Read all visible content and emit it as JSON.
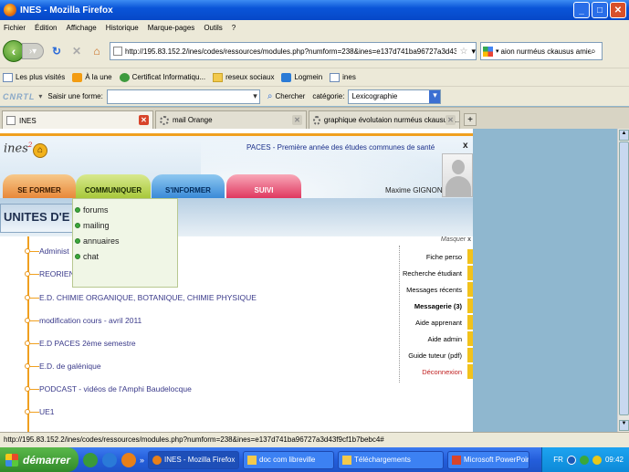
{
  "window": {
    "title": "INES - Mozilla Firefox"
  },
  "menu": [
    "Fichier",
    "Édition",
    "Affichage",
    "Historique",
    "Marque-pages",
    "Outils",
    "?"
  ],
  "nav": {
    "url": "http://195.83.152.2/ines/codes/ressources/modules.php?numform=238&ines=e137d741ba96727a3d43f9cf1b7bebc4#",
    "search_value": "aion nurméus ckausus amiens"
  },
  "bookmarks": [
    "Les plus visités",
    "À la une",
    "Certificat Informatiqu...",
    "reseux sociaux",
    "Logmein",
    "ines"
  ],
  "cnrtl": {
    "logo": "CNRTL",
    "label": "Saisir une forme:",
    "form_value": "",
    "search_button": "Chercher",
    "category_label": "catégorie:",
    "category_value": "Lexicographie"
  },
  "tabs": [
    {
      "label": "INES",
      "active": true
    },
    {
      "label": "mail Orange",
      "active": false
    },
    {
      "label": "graphique évolutaion nurméus ckausus ...",
      "active": false
    }
  ],
  "page": {
    "header_title": "PACES - Première année des études communes de santé",
    "user_name": "Maxime GIGNON",
    "nav_tabs": [
      "SE FORMER",
      "COMMUNIQUER",
      "S'INFORMER",
      "SUIVI"
    ],
    "section_title": "UNITES D'E",
    "dropdown": [
      "forums",
      "mailing",
      "annuaires",
      "chat"
    ],
    "units": [
      "Administ",
      "REORIENTA",
      "E.D. CHIMIE ORGANIQUE, BOTANIQUE, CHIMIE PHYSIQUE",
      "modification cours - avril 2011",
      "E.D PACES 2ème semestre",
      "E.D. de galénique",
      "PODCAST - vidéos de l'Amphi Baudelocque",
      "UE1"
    ],
    "side_panel": {
      "hide_label": "Masquer",
      "items": [
        "Fiche perso",
        "Recherche étudiant",
        "Messages récents",
        "Messagerie (3)",
        "Aide apprenant",
        "Aide admin",
        "Guide tuteur (pdf)",
        "Déconnexion"
      ]
    }
  },
  "status_url": "http://195.83.152.2/ines/codes/ressources/modules.php?numform=238&ines=e137d741ba96727a3d43f9cf1b7bebc4#",
  "taskbar": {
    "start_label": "démarrer",
    "buttons": [
      "INES - Mozilla Firefox",
      "doc com libreville",
      "Téléchargements",
      "Microsoft PowerPoint ..."
    ],
    "lang": "FR",
    "clock": "09:42"
  }
}
